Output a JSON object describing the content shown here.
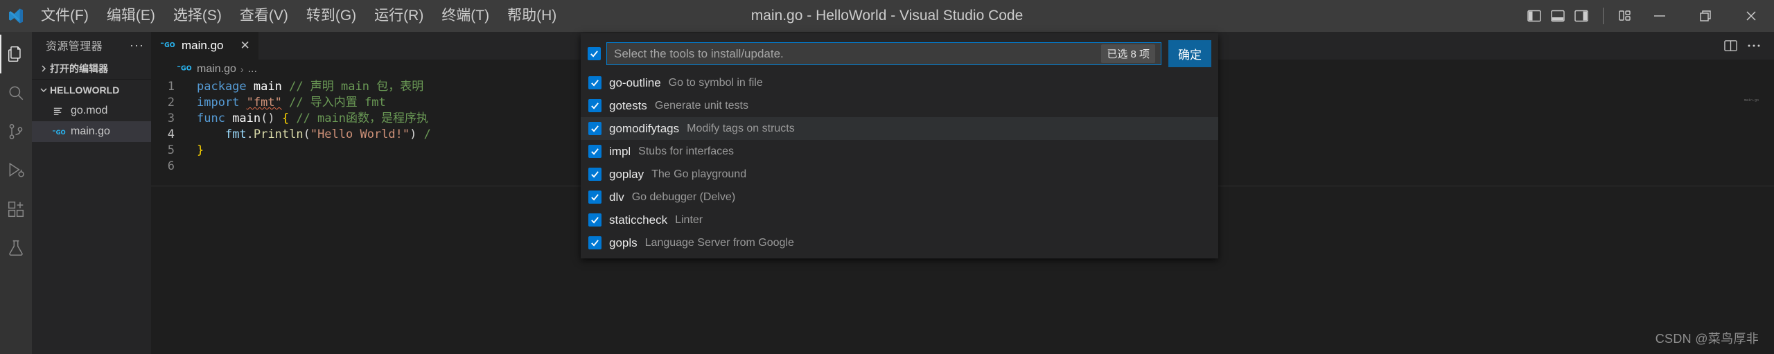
{
  "titlebar": {
    "menus": [
      "文件(F)",
      "编辑(E)",
      "选择(S)",
      "查看(V)",
      "转到(G)",
      "运行(R)",
      "终端(T)",
      "帮助(H)"
    ],
    "window_title": "main.go - HelloWorld - Visual Studio Code",
    "layout_buttons": [
      "toggle-primary-sidebar",
      "toggle-panel",
      "toggle-secondary-sidebar",
      "customize-layout"
    ],
    "window_controls": [
      "minimize",
      "maximize",
      "close"
    ]
  },
  "activitybar": {
    "items": [
      {
        "name": "explorer",
        "icon": "files-icon",
        "active": true
      },
      {
        "name": "search",
        "icon": "search-icon",
        "active": false
      },
      {
        "name": "source-control",
        "icon": "source-control-icon",
        "active": false
      },
      {
        "name": "run-and-debug",
        "icon": "run-debug-icon",
        "active": false
      },
      {
        "name": "extensions",
        "icon": "extensions-icon",
        "active": false
      },
      {
        "name": "testing",
        "icon": "beaker-icon",
        "active": false
      }
    ]
  },
  "sidebar": {
    "title": "资源管理器",
    "more_actions": "···",
    "sections": [
      {
        "label": "打开的编辑器",
        "expanded": false
      },
      {
        "label": "HELLOWORLD",
        "expanded": true
      }
    ],
    "files": [
      {
        "label": "go.mod",
        "icon": "gomod-icon",
        "selected": false
      },
      {
        "label": "main.go",
        "icon": "go-icon",
        "selected": true
      }
    ]
  },
  "editor": {
    "tab": {
      "label": "main.go",
      "icon": "go-icon",
      "close": "✕"
    },
    "tab_actions": [
      "split-editor",
      "more-actions"
    ],
    "breadcrumb": {
      "icon": "go-icon",
      "file": "main.go",
      "separator": "›",
      "rest": "..."
    },
    "lines": [
      {
        "no": "1",
        "segments": [
          {
            "t": "package ",
            "c": "kw"
          },
          {
            "t": "main",
            "c": "pkg"
          },
          {
            "t": " // 声明 main 包，表明",
            "c": "cmt"
          }
        ]
      },
      {
        "no": "2",
        "segments": [
          {
            "t": "import ",
            "c": "kw"
          },
          {
            "t": "\"fmt\"",
            "c": "str underl"
          },
          {
            "t": " // 导入内置 fmt",
            "c": "cmt"
          }
        ]
      },
      {
        "no": "3",
        "segments": [
          {
            "t": "func ",
            "c": "kw"
          },
          {
            "t": "main",
            "c": "pkg"
          },
          {
            "t": "() ",
            "c": "plain"
          },
          {
            "t": "{",
            "c": "sq"
          },
          {
            "t": " // main函数，是程序执",
            "c": "cmt"
          }
        ]
      },
      {
        "no": "4",
        "segments": [
          {
            "t": "    ",
            "c": "plain"
          },
          {
            "t": "fmt",
            "c": "id"
          },
          {
            "t": ".",
            "c": "plain"
          },
          {
            "t": "Println",
            "c": "fn"
          },
          {
            "t": "(",
            "c": "plain"
          },
          {
            "t": "\"Hello World!\"",
            "c": "str"
          },
          {
            "t": ")",
            "c": "plain"
          },
          {
            "t": " /",
            "c": "cmt"
          }
        ]
      },
      {
        "no": "5",
        "segments": [
          {
            "t": "}",
            "c": "sq"
          }
        ]
      },
      {
        "no": "6",
        "segments": [
          {
            "t": "",
            "c": "plain"
          }
        ]
      }
    ]
  },
  "quickpick": {
    "select_all_checked": true,
    "placeholder": "Select the tools to install/update.",
    "count_badge": "已选 8 项",
    "ok_label": "确定",
    "items": [
      {
        "label": "go-outline",
        "desc": "Go to symbol in file",
        "checked": true,
        "focused": false
      },
      {
        "label": "gotests",
        "desc": "Generate unit tests",
        "checked": true,
        "focused": false
      },
      {
        "label": "gomodifytags",
        "desc": "Modify tags on structs",
        "checked": true,
        "focused": true
      },
      {
        "label": "impl",
        "desc": "Stubs for interfaces",
        "checked": true,
        "focused": false
      },
      {
        "label": "goplay",
        "desc": "The Go playground",
        "checked": true,
        "focused": false
      },
      {
        "label": "dlv",
        "desc": "Go debugger (Delve)",
        "checked": true,
        "focused": false
      },
      {
        "label": "staticcheck",
        "desc": "Linter",
        "checked": true,
        "focused": false
      },
      {
        "label": "gopls",
        "desc": "Language Server from Google",
        "checked": true,
        "focused": false
      }
    ]
  },
  "watermark": "CSDN @菜鸟厚非",
  "colors": {
    "accent": "#0078d4",
    "titlebar_bg": "#3c3c3c",
    "sidebar_bg": "#252526",
    "editor_bg": "#1e1e1e",
    "activitybar_bg": "#333333",
    "ok_button": "#0e639c"
  }
}
